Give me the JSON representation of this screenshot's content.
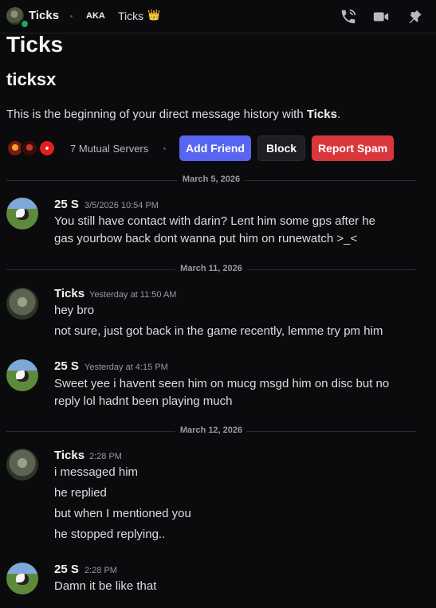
{
  "header": {
    "name": "Ticks",
    "aka_label": "AKA",
    "aka_name": "Ticks",
    "crown": "👑",
    "icons": [
      "voice-call-icon",
      "video-call-icon",
      "pin-icon"
    ]
  },
  "intro": {
    "title": "Ticks",
    "username": "ticksx",
    "text_prefix": "This is the beginning of your direct message history with ",
    "text_name": "Ticks",
    "text_suffix": ".",
    "mutual_servers": "7 Mutual Servers",
    "buttons": {
      "add_friend": "Add Friend",
      "block": "Block",
      "report_spam": "Report Spam"
    }
  },
  "colors": {
    "background": "#0b0b0d",
    "blurple": "#5865f2",
    "danger": "#da373c",
    "online": "#23a55a"
  },
  "dividers": [
    "March 5, 2026",
    "March 11, 2026",
    "March 12, 2026"
  ],
  "messages": [
    {
      "author": "25 S",
      "timestamp": "3/5/2026 10:54 PM",
      "lines": [
        "You still have contact with darin?  Lent him some gps after he",
        "gas yourbow back dont wanna put him on runewatch >_<"
      ]
    },
    {
      "author": "Ticks",
      "timestamp": "Yesterday at 11:50 AM",
      "lines": [
        "hey bro",
        "not sure, just got back in the game recently, lemme try pm him"
      ]
    },
    {
      "author": "25 S",
      "timestamp": "Yesterday at 4:15 PM",
      "lines": [
        "Sweet yee i havent seen him on mucg msgd him on disc but no",
        "reply lol hadnt been playing much"
      ]
    },
    {
      "author": "Ticks",
      "timestamp": "2:28 PM",
      "lines": [
        "i messaged him",
        "he replied",
        "but when I mentioned you",
        "he stopped replying.."
      ]
    },
    {
      "author": "25 S",
      "timestamp": "2:28 PM",
      "lines": [
        "Damn it be like that"
      ]
    }
  ]
}
